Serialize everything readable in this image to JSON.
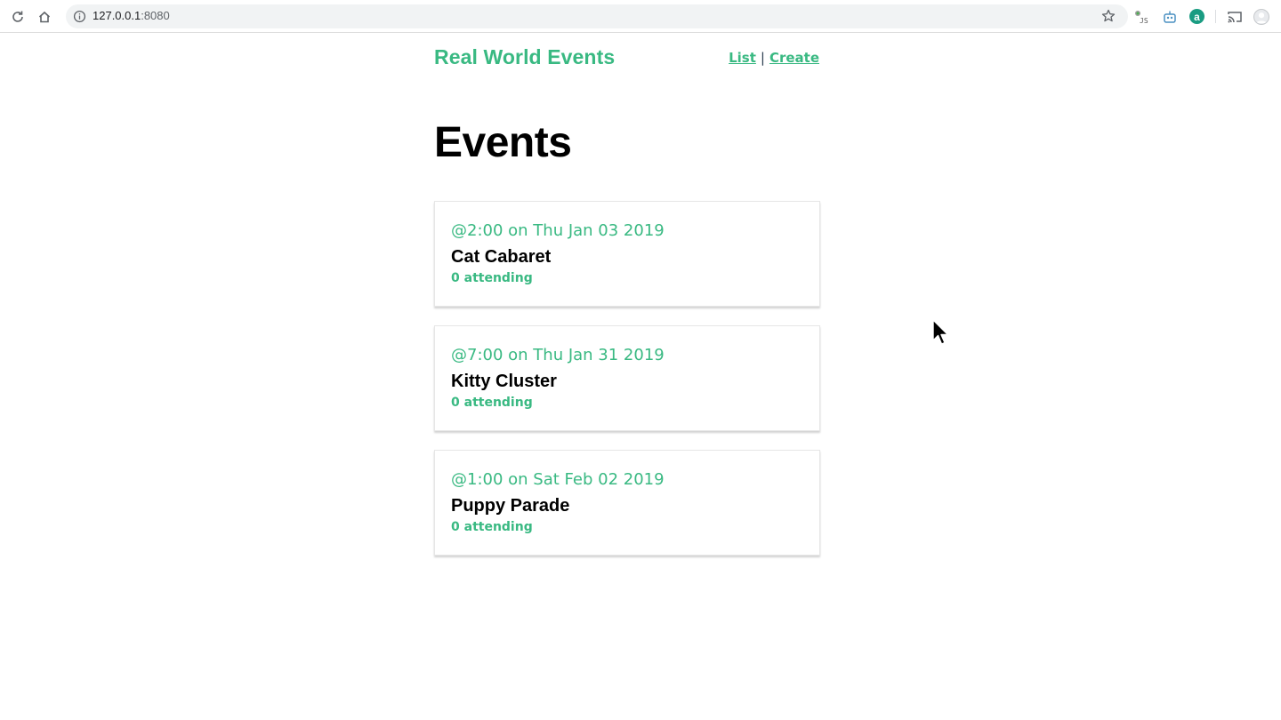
{
  "browser": {
    "url_host": "127.0.0.1",
    "url_port": ":8080",
    "ext_js_label": "JS",
    "ext_a_label": "a"
  },
  "navbar": {
    "brand": "Real World Events",
    "links": [
      {
        "label": "List"
      },
      {
        "label": "Create"
      }
    ],
    "separator": "|"
  },
  "page": {
    "title": "Events"
  },
  "events": [
    {
      "when": "@2:00 on Thu Jan 03 2019",
      "title": "Cat Cabaret",
      "attending": "0 attending"
    },
    {
      "when": "@7:00 on Thu Jan 31 2019",
      "title": "Kitty Cluster",
      "attending": "0 attending"
    },
    {
      "when": "@1:00 on Sat Feb 02 2019",
      "title": "Puppy Parade",
      "attending": "0 attending"
    }
  ],
  "colors": {
    "accent": "#39b982",
    "text": "#000000"
  },
  "icons": [
    "reload-icon",
    "home-icon",
    "info-icon",
    "star-icon",
    "js-extension-icon",
    "robot-extension-icon",
    "a-extension-icon",
    "cast-icon",
    "profile-avatar-icon",
    "mouse-cursor-icon"
  ]
}
